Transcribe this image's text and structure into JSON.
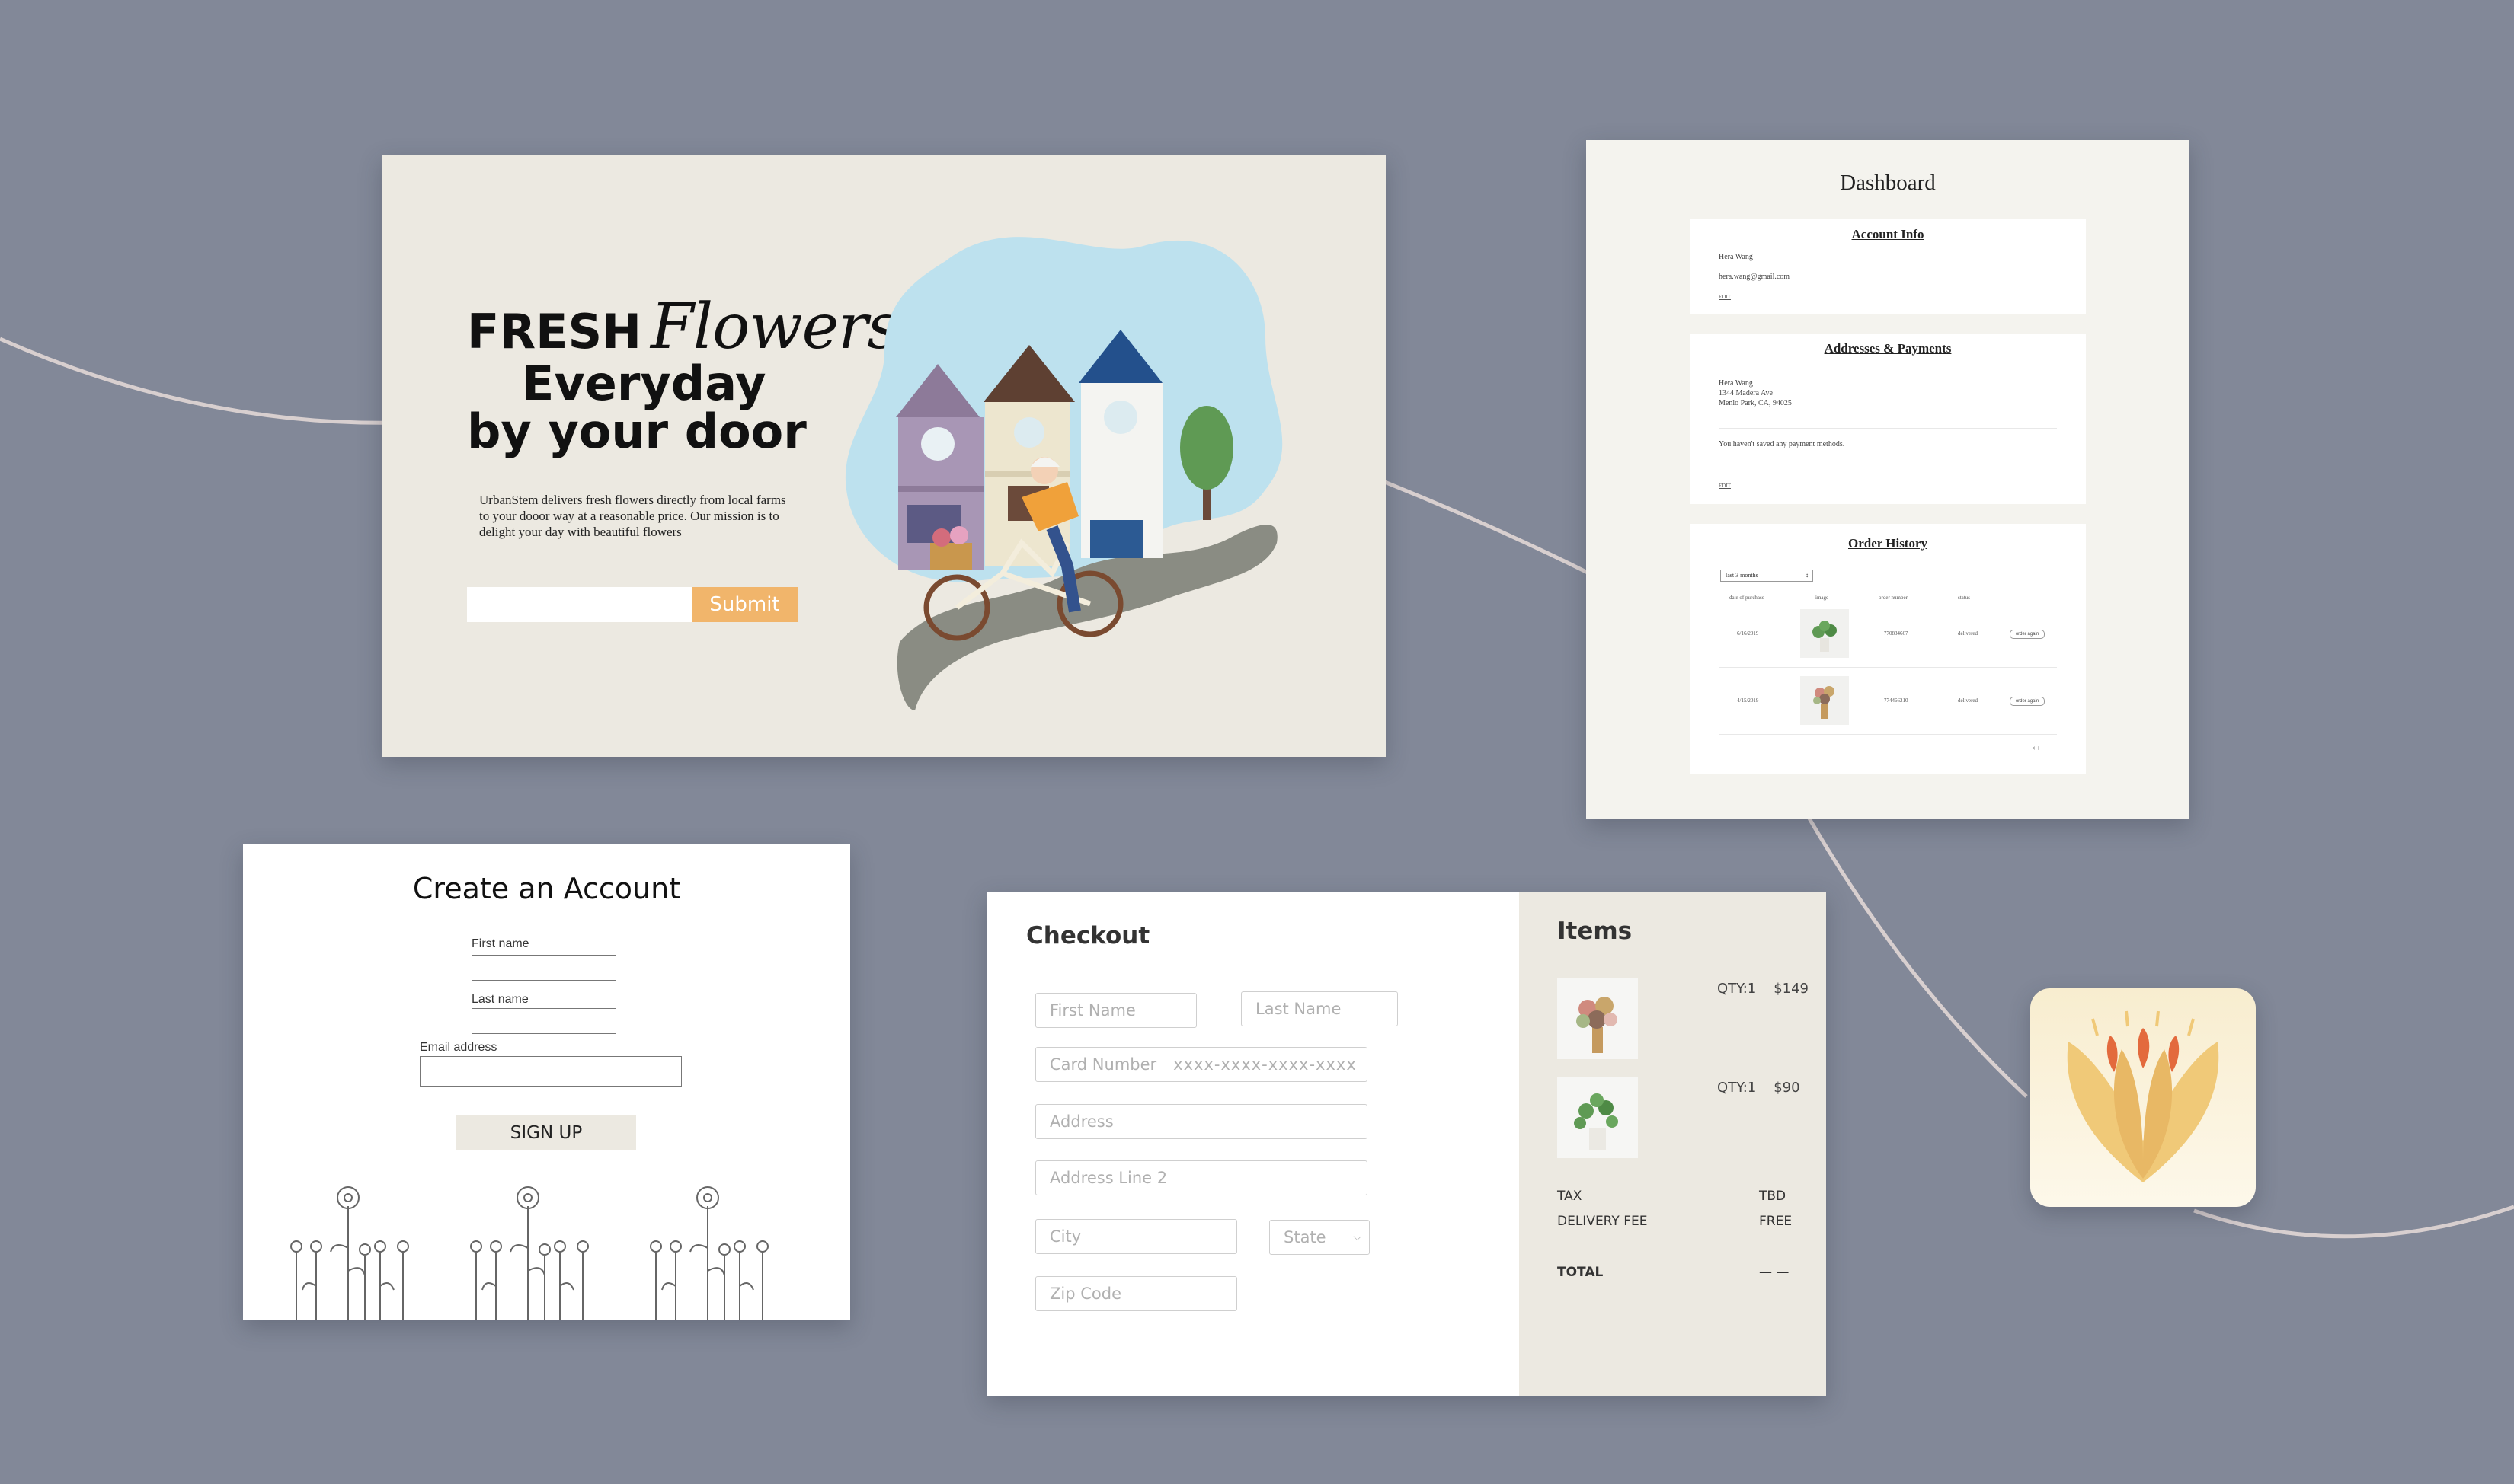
{
  "hero": {
    "headline_fresh": "FRESH",
    "headline_flowers": "Flowers",
    "headline_everyday": "Everyday",
    "headline_door": "by your door",
    "description": "UrbanStem delivers fresh flowers directly from local farms to your dooor way at a reasonable price. Our mission is to delight your day with beautiful flowers",
    "email_value": "",
    "submit_label": "Submit"
  },
  "dashboard": {
    "title": "Dashboard",
    "account_info": {
      "title": "Account Info",
      "name": "Hera Wang",
      "email": "hera.wang@gmail.com",
      "edit": "EDIT"
    },
    "addresses": {
      "title": "Addresses & Payments",
      "line1": "Hera Wang",
      "line2": "1344 Madera Ave",
      "line3": "Menlo Park, CA, 94025",
      "no_payment": "You haven't saved any payment methods.",
      "edit": "EDIT"
    },
    "order_history": {
      "title": "Order History",
      "filter": "last 3 months",
      "columns": [
        "date of purchase",
        "image",
        "order number",
        "status"
      ],
      "rows": [
        {
          "date": "6/16/2019",
          "order": "770834667",
          "status": "delivered",
          "action": "order again"
        },
        {
          "date": "4/15/2019",
          "order": "774466210",
          "status": "delivered",
          "action": "order again"
        }
      ],
      "pager": "‹ ›"
    }
  },
  "account": {
    "title": "Create an Account",
    "first_name_label": "First name",
    "last_name_label": "Last name",
    "email_label": "Email address",
    "signup_label": "SIGN UP"
  },
  "checkout": {
    "title": "Checkout",
    "first_name": "First Name",
    "last_name": "Last Name",
    "card_number": "Card Number",
    "card_mask": "xxxx-xxxx-xxxx-xxxx",
    "address": "Address",
    "address2": "Address Line 2",
    "city": "City",
    "state": "State",
    "zip": "Zip Code",
    "items_title": "Items",
    "items": [
      {
        "qty": "QTY:1",
        "price": "$149"
      },
      {
        "qty": "QTY:1",
        "price": "$90"
      }
    ],
    "tax_label": "TAX",
    "tax_value": "TBD",
    "delivery_label": "DELIVERY FEE",
    "delivery_value": "FREE",
    "total_label": "TOTAL",
    "total_value": "— —"
  },
  "colors": {
    "background": "#828898",
    "accent_orange": "#f1b56b",
    "cream": "#ece9e1"
  }
}
